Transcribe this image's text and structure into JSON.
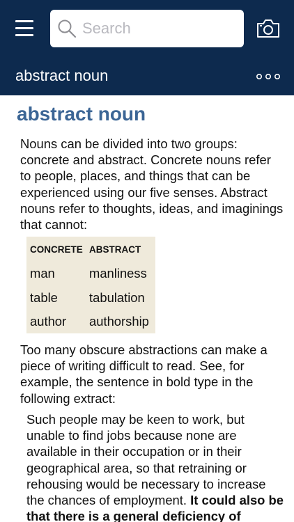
{
  "search": {
    "placeholder": "Search"
  },
  "header": {
    "title": "abstract noun"
  },
  "entry": {
    "headword": "abstract noun",
    "intro": "Nouns can be divided into two groups: concrete and abstract. Concrete nouns refer to people, places, and things that can be experienced using our five senses. Abstract nouns refer to thoughts, ideas, and imaginings that cannot:",
    "table": {
      "headers": [
        "CONCRETE",
        "ABSTRACT"
      ],
      "rows": [
        [
          "man",
          "manliness"
        ],
        [
          "table",
          "tabulation"
        ],
        [
          "author",
          "authorship"
        ]
      ]
    },
    "para2": "Too many obscure abstractions can make a piece of writing difficult to read. See, for example, the sentence in bold type in the following extract:",
    "quote_normal": "Such people may be keen to work, but unable to find jobs because none are available in their occupation or in their geographical area, so that retraining or rehousing would be necessary to increase the chances of employment. ",
    "quote_bold": "It could also be that there is a general deficiency of"
  },
  "colors": {
    "nav": "#0d2a4e",
    "heading": "#3b6595",
    "table_bg": "#efeadb"
  },
  "icons": [
    "menu-icon",
    "search-icon",
    "camera-icon",
    "more-icon"
  ]
}
